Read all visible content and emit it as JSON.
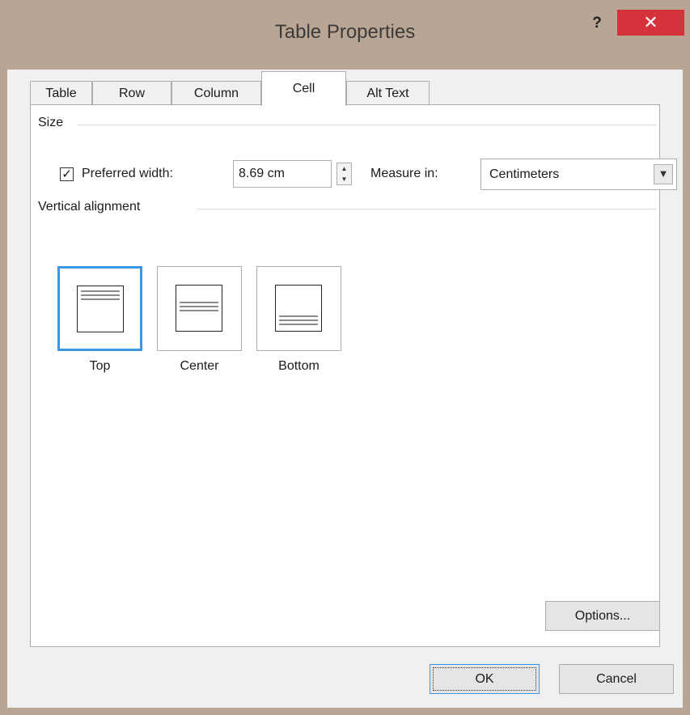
{
  "dialog": {
    "title": "Table Properties",
    "help_label": "?",
    "close_label": "✕"
  },
  "tabs": [
    {
      "label": "Table",
      "underline": "T",
      "active": false
    },
    {
      "label": "Row",
      "underline": "R",
      "active": false
    },
    {
      "label": "Column",
      "underline": "u",
      "active": false
    },
    {
      "label": "Cell",
      "underline": "e",
      "active": true
    },
    {
      "label": "Alt Text",
      "underline": "A",
      "active": false
    }
  ],
  "size_group": {
    "label": "Size",
    "preferred_width_checked": true,
    "preferred_width_label": "Preferred width:",
    "width_value": "8.69 cm",
    "measure_in_label": "Measure in:",
    "measure_in_value": "Centimeters"
  },
  "vertical_alignment": {
    "label": "Vertical alignment",
    "options": [
      {
        "label": "Top",
        "selected": true
      },
      {
        "label": "Center",
        "selected": false
      },
      {
        "label": "Bottom",
        "selected": false
      }
    ]
  },
  "buttons": {
    "options": "Options...",
    "ok": "OK",
    "cancel": "Cancel"
  },
  "colors": {
    "title_bar": "#b9a594",
    "close_button": "#d5323b",
    "selection_border": "#3c95e5"
  }
}
